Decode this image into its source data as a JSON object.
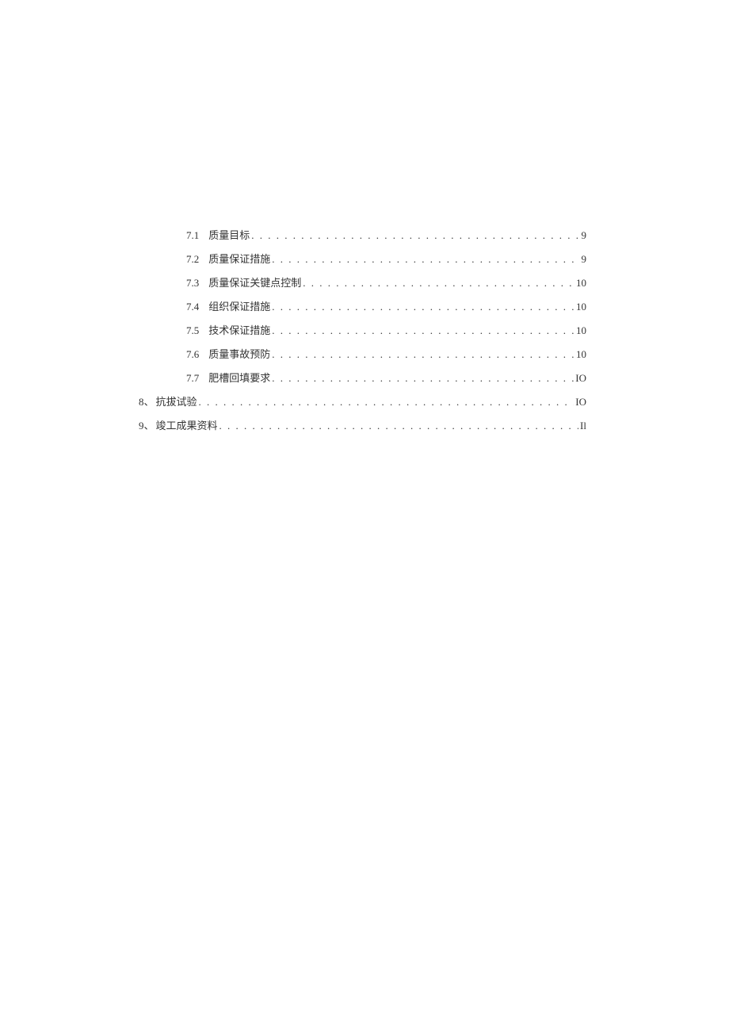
{
  "toc": [
    {
      "level": 2,
      "num": "7.1",
      "label": "质量目标",
      "page": "9"
    },
    {
      "level": 2,
      "num": "7.2",
      "label": "质量保证措施",
      "page": "9"
    },
    {
      "level": 2,
      "num": "7.3",
      "label": "质量保证关键点控制",
      "page": "10"
    },
    {
      "level": 2,
      "num": "7.4",
      "label": "组织保证措施",
      "page": "10"
    },
    {
      "level": 2,
      "num": "7.5",
      "label": "技术保证措施",
      "page": "10"
    },
    {
      "level": 2,
      "num": "7.6",
      "label": "质量事故预防",
      "page": "10"
    },
    {
      "level": 2,
      "num": "7.7",
      "label": "肥槽回填要求",
      "page": "IO"
    },
    {
      "level": 1,
      "num": "8、",
      "label": "抗拔试验",
      "page": "IO"
    },
    {
      "level": 1,
      "num": "9、",
      "label": "竣工成果资料",
      "page": "Il"
    }
  ]
}
